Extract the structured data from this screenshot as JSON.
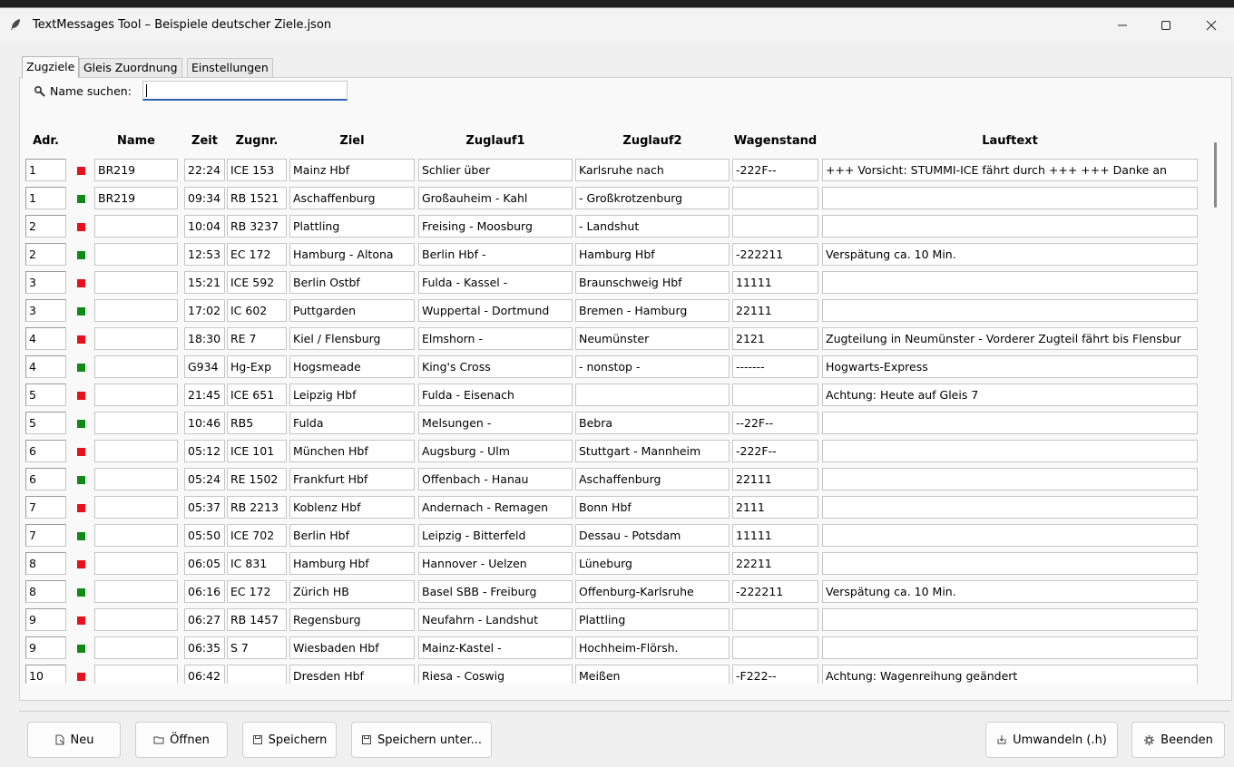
{
  "window": {
    "title": "TextMessages Tool – Beispiele deutscher Ziele.json",
    "controls": {
      "minimize": "—",
      "maximize": "☐",
      "close": "✕"
    }
  },
  "tabs": [
    {
      "label": "Zugziele",
      "active": true
    },
    {
      "label": "Gleis Zuordnung",
      "active": false
    },
    {
      "label": "Einstellungen",
      "active": false
    }
  ],
  "search": {
    "label": "Name suchen:",
    "value": ""
  },
  "table": {
    "headers": {
      "adr": "Adr.",
      "name": "Name",
      "zeit": "Zeit",
      "zugnr": "Zugnr.",
      "ziel": "Ziel",
      "zuglauf1": "Zuglauf1",
      "zuglauf2": "Zuglauf2",
      "wagenstand": "Wagenstand",
      "lauftext": "Lauftext"
    },
    "colors": {
      "red": "#e8101a",
      "green": "#0e8a17"
    },
    "rows": [
      {
        "adr": "1",
        "indicator": "red",
        "name": "BR219",
        "zeit": "22:24",
        "zugnr": "ICE 153",
        "ziel": "Mainz Hbf",
        "zuglauf1": "Schlier über",
        "zuglauf2": "Karlsruhe nach",
        "wagenstand": "-222F--",
        "lauftext": "+++ Vorsicht: STUMMI-ICE fährt durch +++      +++ Danke an"
      },
      {
        "adr": "1",
        "indicator": "green",
        "name": "BR219",
        "zeit": "09:34",
        "zugnr": "RB 1521",
        "ziel": "Aschaffenburg",
        "zuglauf1": "Großauheim - Kahl",
        "zuglauf2": "- Großkrotzenburg",
        "wagenstand": "",
        "lauftext": ""
      },
      {
        "adr": "2",
        "indicator": "red",
        "name": "",
        "zeit": "10:04",
        "zugnr": "RB 3237",
        "ziel": "Plattling",
        "zuglauf1": "Freising - Moosburg",
        "zuglauf2": "- Landshut",
        "wagenstand": "",
        "lauftext": ""
      },
      {
        "adr": "2",
        "indicator": "green",
        "name": "",
        "zeit": "12:53",
        "zugnr": "EC 172",
        "ziel": "Hamburg - Altona",
        "zuglauf1": "Berlin Hbf -",
        "zuglauf2": "Hamburg Hbf",
        "wagenstand": "-222211",
        "lauftext": "Verspätung ca. 10 Min."
      },
      {
        "adr": "3",
        "indicator": "red",
        "name": "",
        "zeit": "15:21",
        "zugnr": "ICE 592",
        "ziel": "Berlin Ostbf",
        "zuglauf1": "Fulda - Kassel -",
        "zuglauf2": "Braunschweig Hbf",
        "wagenstand": "11111",
        "lauftext": ""
      },
      {
        "adr": "3",
        "indicator": "green",
        "name": "",
        "zeit": "17:02",
        "zugnr": "IC 602",
        "ziel": "Puttgarden",
        "zuglauf1": "Wuppertal - Dortmund",
        "zuglauf2": "Bremen - Hamburg",
        "wagenstand": "22111",
        "lauftext": ""
      },
      {
        "adr": "4",
        "indicator": "red",
        "name": "",
        "zeit": "18:30",
        "zugnr": "RE 7",
        "ziel": "Kiel / Flensburg",
        "zuglauf1": "Elmshorn -",
        "zuglauf2": "Neumünster",
        "wagenstand": "2121",
        "lauftext": "Zugteilung in Neumünster - Vorderer Zugteil fährt bis Flensbur"
      },
      {
        "adr": "4",
        "indicator": "green",
        "name": "",
        "zeit": "G934",
        "zugnr": "Hg-Exp",
        "ziel": "Hogsmeade",
        "zuglauf1": "King's Cross",
        "zuglauf2": "- nonstop -",
        "wagenstand": "-------",
        "lauftext": "Hogwarts-Express"
      },
      {
        "adr": "5",
        "indicator": "red",
        "name": "",
        "zeit": "21:45",
        "zugnr": "ICE 651",
        "ziel": "Leipzig Hbf",
        "zuglauf1": "Fulda - Eisenach",
        "zuglauf2": "",
        "wagenstand": "",
        "lauftext": "Achtung: Heute auf Gleis 7"
      },
      {
        "adr": "5",
        "indicator": "green",
        "name": "",
        "zeit": "10:46",
        "zugnr": "RB5",
        "ziel": "Fulda",
        "zuglauf1": "Melsungen -",
        "zuglauf2": "Bebra",
        "wagenstand": "--22F--",
        "lauftext": ""
      },
      {
        "adr": "6",
        "indicator": "red",
        "name": "",
        "zeit": "05:12",
        "zugnr": "ICE 101",
        "ziel": "München Hbf",
        "zuglauf1": "Augsburg - Ulm",
        "zuglauf2": "Stuttgart - Mannheim",
        "wagenstand": "-222F--",
        "lauftext": ""
      },
      {
        "adr": "6",
        "indicator": "green",
        "name": "",
        "zeit": "05:24",
        "zugnr": "RE 1502",
        "ziel": "Frankfurt Hbf",
        "zuglauf1": "Offenbach - Hanau",
        "zuglauf2": "Aschaffenburg",
        "wagenstand": "22111",
        "lauftext": ""
      },
      {
        "adr": "7",
        "indicator": "red",
        "name": "",
        "zeit": "05:37",
        "zugnr": "RB 2213",
        "ziel": "Koblenz Hbf",
        "zuglauf1": "Andernach - Remagen",
        "zuglauf2": "Bonn Hbf",
        "wagenstand": "2111",
        "lauftext": ""
      },
      {
        "adr": "7",
        "indicator": "green",
        "name": "",
        "zeit": "05:50",
        "zugnr": "ICE 702",
        "ziel": "Berlin Hbf",
        "zuglauf1": "Leipzig - Bitterfeld",
        "zuglauf2": "Dessau - Potsdam",
        "wagenstand": "11111",
        "lauftext": ""
      },
      {
        "adr": "8",
        "indicator": "red",
        "name": "",
        "zeit": "06:05",
        "zugnr": "IC 831",
        "ziel": "Hamburg Hbf",
        "zuglauf1": "Hannover - Uelzen",
        "zuglauf2": "Lüneburg",
        "wagenstand": "22211",
        "lauftext": ""
      },
      {
        "adr": "8",
        "indicator": "green",
        "name": "",
        "zeit": "06:16",
        "zugnr": "EC 172",
        "ziel": "Zürich HB",
        "zuglauf1": "Basel SBB - Freiburg",
        "zuglauf2": "Offenburg-Karlsruhe",
        "wagenstand": "-222211",
        "lauftext": "Verspätung ca. 10 Min."
      },
      {
        "adr": "9",
        "indicator": "red",
        "name": "",
        "zeit": "06:27",
        "zugnr": "RB 1457",
        "ziel": "Regensburg",
        "zuglauf1": "Neufahrn - Landshut",
        "zuglauf2": "Plattling",
        "wagenstand": "",
        "lauftext": ""
      },
      {
        "adr": "9",
        "indicator": "green",
        "name": "",
        "zeit": "06:35",
        "zugnr": "S 7",
        "ziel": "Wiesbaden Hbf",
        "zuglauf1": "Mainz-Kastel -",
        "zuglauf2": "Hochheim-Flörsh.",
        "wagenstand": "",
        "lauftext": ""
      },
      {
        "adr": "10",
        "indicator": "red",
        "name": "",
        "zeit": "06:42",
        "zugnr": "",
        "ziel": "Dresden Hbf",
        "zuglauf1": "Riesa - Coswig",
        "zuglauf2": "Meißen",
        "wagenstand": "-F222--",
        "lauftext": "Achtung: Wagenreihung geändert"
      }
    ]
  },
  "buttons": {
    "neu": {
      "label": "Neu",
      "icon": "new-file-icon"
    },
    "oeffnen": {
      "label": "Öffnen",
      "icon": "folder-icon"
    },
    "speichern": {
      "label": "Speichern",
      "icon": "save-icon"
    },
    "speichern_unter": {
      "label": "Speichern unter...",
      "icon": "save-icon"
    },
    "umwandeln": {
      "label": "Umwandeln (.h)",
      "icon": "convert-icon"
    },
    "beenden": {
      "label": "Beenden",
      "icon": "gear-icon"
    }
  }
}
